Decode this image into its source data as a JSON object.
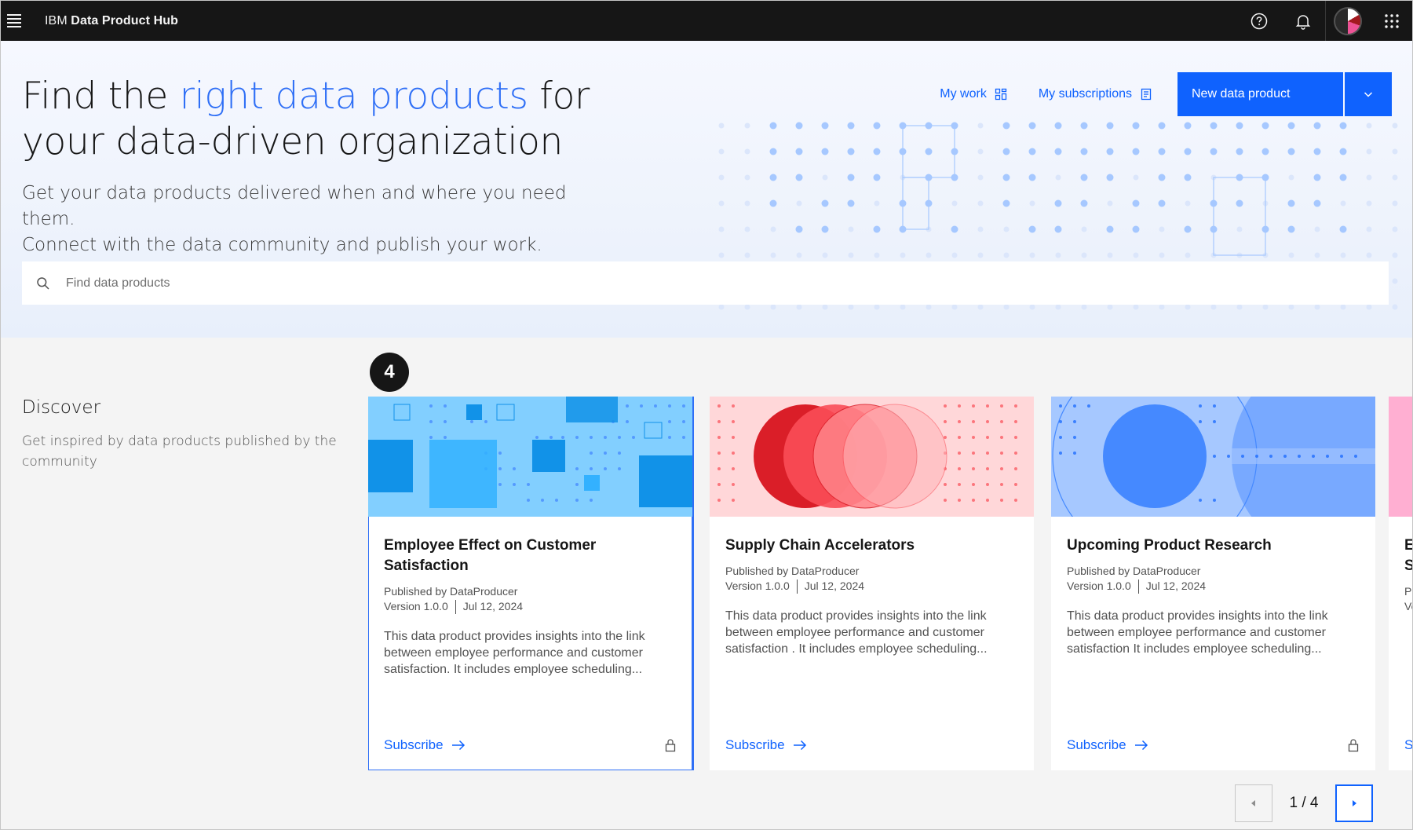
{
  "header": {
    "brand_prefix": "IBM",
    "brand_name": "Data Product Hub"
  },
  "hero": {
    "title_part1": "Find the ",
    "title_highlight": "right data products",
    "title_part2": " for your data-driven organization",
    "subtitle_line1": "Get your data products delivered when and where you need them.",
    "subtitle_line2": "Connect with the data community and publish your work.",
    "my_work_label": "My work",
    "my_subscriptions_label": "My subscriptions",
    "new_product_label": "New data product"
  },
  "search": {
    "placeholder": "Find data products"
  },
  "discover": {
    "title": "Discover",
    "description": "Get inspired by data products published by the community",
    "step_number": "4"
  },
  "cards": [
    {
      "title": "Employee Effect on Customer Satisfaction",
      "published": "Published by DataProducer",
      "version": "Version 1.0.0",
      "date": "Jul 12, 2024",
      "description": "This data product provides insights into the link between employee performance and customer satisfaction. It includes employee scheduling...",
      "subscribe_label": "Subscribe",
      "locked": true
    },
    {
      "title": "Supply Chain Accelerators",
      "published": "Published by DataProducer",
      "version": "Version 1.0.0",
      "date": "Jul 12, 2024",
      "description": "This data product provides insights into the link between employee performance and customer satisfaction . It includes employee scheduling...",
      "subscribe_label": "Subscribe",
      "locked": false
    },
    {
      "title": "Upcoming Product Research",
      "published": "Published by DataProducer",
      "version": "Version 1.0.0",
      "date": "Jul 12, 2024",
      "description": "This data product provides insights into the link between employee performance and customer satisfaction It includes employee scheduling...",
      "subscribe_label": "Subscribe",
      "locked": true
    },
    {
      "title": "Em Sa",
      "published": "Pu",
      "version": "Ve",
      "subscribe_label": "Su"
    }
  ],
  "pagination": {
    "label": "1 / 4"
  },
  "colors": {
    "accent": "#0f62fe",
    "highlight": "#2f6ff6",
    "topbar": "#161616"
  }
}
